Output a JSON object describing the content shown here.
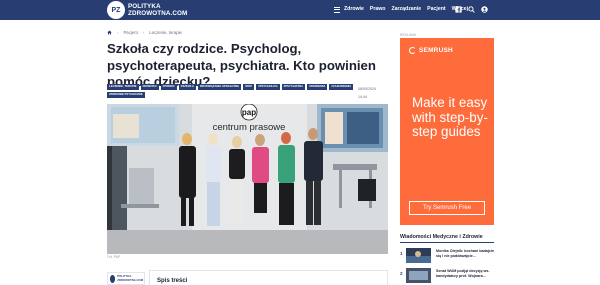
{
  "header": {
    "logo_badge": "PZ",
    "logo_line1": "POLITYKA",
    "logo_line2": "ZDROWOTNA.COM",
    "nav": [
      "Zdrowie",
      "Prawo",
      "Zarządzanie",
      "Pacjent",
      "Więcej"
    ],
    "icons": [
      "facebook-icon",
      "search-icon",
      "user-icon"
    ]
  },
  "breadcrumb": {
    "items": [
      "Pacjent",
      "Leczenie, terapie"
    ]
  },
  "article": {
    "title": "Szkoła czy rodzice. Psycholog, psychoterapeuta, psychiatra. Kto powinien pomóc dziecku?",
    "tags": [
      "LECZENIE, TERAPIE",
      "#DZIECKO",
      "#POMOC",
      "#SZKOŁA",
      "#ROZWIĄZANIA SPOŁECZNE",
      "#PAP",
      "#PSYCHOLOG",
      "#PSYCHIATRA",
      "#PANDEMIA",
      "#ZABURZENIA",
      "#ZDROWIE PSYCHICZNE"
    ],
    "date": "08/05/2024",
    "time": "14:44",
    "photo_sign_top": "pap",
    "photo_sign_bottom": "centrum prasowe",
    "photo_caption": "Fot. PAP",
    "toc_logo_text": "POLITYKA ZDROWOTNA.COM",
    "toc_label": "Spis treści"
  },
  "ad": {
    "label": "REKLAMA",
    "brand": "SEMRUSH",
    "headline": "Make it easy with step-by-step guides",
    "cta": "Try Semrush Free",
    "colors": {
      "background": "#fe6c3b",
      "text": "#ffffff"
    }
  },
  "news": {
    "heading": "Wiadomości Medyczne i Zdrowie",
    "items": [
      {
        "num": "1",
        "text": "Monika Olejnik: kochani badajcie się i nie poddawajcie..."
      },
      {
        "num": "2",
        "text": "Senat WUM podjął decyzję ws. kandydatury prof. Wojnara..."
      }
    ]
  },
  "colors": {
    "brand": "#283d72",
    "accent": "#fe6c3b"
  }
}
